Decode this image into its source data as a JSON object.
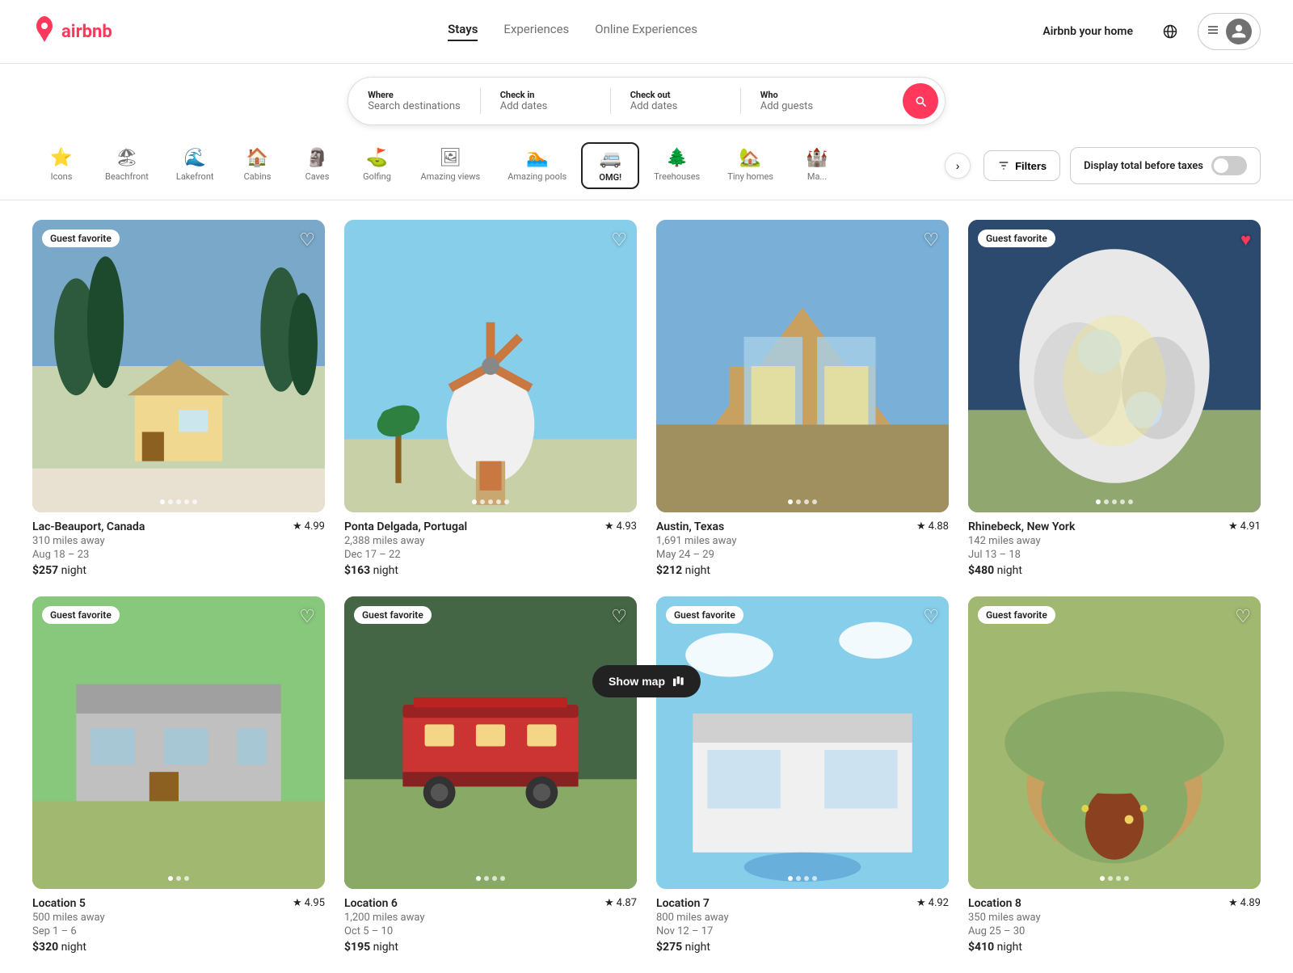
{
  "header": {
    "logo_text": "airbnb",
    "nav_tabs": [
      {
        "label": "Stays",
        "active": true
      },
      {
        "label": "Experiences",
        "active": false
      },
      {
        "label": "Online Experiences",
        "active": false
      }
    ],
    "airbnb_your_home": "Airbnb your home",
    "menu_icon": "☰"
  },
  "search_bar": {
    "where_label": "Where",
    "where_placeholder": "Search destinations",
    "checkin_label": "Check in",
    "checkin_value": "Add dates",
    "checkout_label": "Check out",
    "checkout_value": "Add dates",
    "who_label": "Who",
    "who_value": "Add guests"
  },
  "categories": [
    {
      "label": "Icons",
      "icon": "⭐",
      "active": false
    },
    {
      "label": "Beachfront",
      "icon": "🏖",
      "active": false
    },
    {
      "label": "Lakefront",
      "icon": "🌊",
      "active": false
    },
    {
      "label": "Cabins",
      "icon": "🏠",
      "active": false
    },
    {
      "label": "Caves",
      "icon": "🗿",
      "active": false
    },
    {
      "label": "Golfing",
      "icon": "⛳",
      "active": false
    },
    {
      "label": "Amazing views",
      "icon": "🖼",
      "active": false
    },
    {
      "label": "Amazing pools",
      "icon": "🏊",
      "active": false
    },
    {
      "label": "OMG!",
      "icon": "🚐",
      "active": true
    },
    {
      "label": "Treehouses",
      "icon": "🌲",
      "active": false
    },
    {
      "label": "Tiny homes",
      "icon": "🏡",
      "active": false
    },
    {
      "label": "Mansions",
      "icon": "🏰",
      "active": false
    }
  ],
  "filters_btn": "Filters",
  "tax_label": "Display total before taxes",
  "show_map": "Show map",
  "listings": [
    {
      "id": 1,
      "location": "Lac-Beauport, Canada",
      "rating": "4.99",
      "distance": "310 miles away",
      "dates": "Aug 18 – 23",
      "price": "$257",
      "price_unit": "night",
      "badge": "Guest favorite",
      "card_class": "card-1"
    },
    {
      "id": 2,
      "location": "Ponta Delgada, Portugal",
      "rating": "4.93",
      "distance": "2,388 miles away",
      "dates": "Dec 17 – 22",
      "price": "$163",
      "price_unit": "night",
      "badge": "",
      "card_class": "card-2"
    },
    {
      "id": 3,
      "location": "Austin, Texas",
      "rating": "4.88",
      "distance": "1,691 miles away",
      "dates": "May 24 – 29",
      "price": "$212",
      "price_unit": "night",
      "badge": "",
      "card_class": "card-3"
    },
    {
      "id": 4,
      "location": "Rhinebeck, New York",
      "rating": "4.91",
      "distance": "142 miles away",
      "dates": "Jul 13 – 18",
      "price": "$480",
      "price_unit": "night",
      "badge": "Guest favorite",
      "card_class": "card-4"
    },
    {
      "id": 5,
      "location": "Location 5",
      "rating": "4.95",
      "distance": "500 miles away",
      "dates": "Sep 1 – 6",
      "price": "$320",
      "price_unit": "night",
      "badge": "Guest favorite",
      "card_class": "card-5"
    },
    {
      "id": 6,
      "location": "Location 6",
      "rating": "4.87",
      "distance": "1,200 miles away",
      "dates": "Oct 5 – 10",
      "price": "$195",
      "price_unit": "night",
      "badge": "Guest favorite",
      "card_class": "card-6"
    },
    {
      "id": 7,
      "location": "Location 7",
      "rating": "4.92",
      "distance": "800 miles away",
      "dates": "Nov 12 – 17",
      "price": "$275",
      "price_unit": "night",
      "badge": "Guest favorite",
      "card_class": "card-7"
    },
    {
      "id": 8,
      "location": "Location 8",
      "rating": "4.89",
      "distance": "350 miles away",
      "dates": "Aug 25 – 30",
      "price": "$410",
      "price_unit": "night",
      "badge": "Guest favorite",
      "card_class": "card-8"
    }
  ]
}
